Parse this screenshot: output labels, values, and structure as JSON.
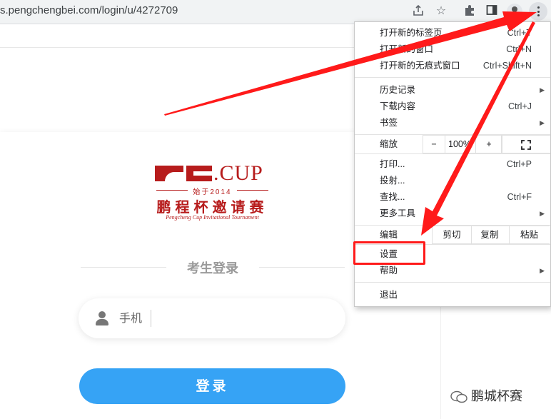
{
  "browser": {
    "url": "s.pengchengbei.com/login/u/4272709",
    "icons": [
      "share-icon",
      "star-icon",
      "extensions-icon",
      "side-panel-icon",
      "profile-icon",
      "menu-icon"
    ]
  },
  "logo": {
    "cup_text": ".CUP",
    "since": "始于2014",
    "name_cn": "鹏程杯邀请赛",
    "name_en": "Pengcheng Cup Invitational Tournament"
  },
  "login": {
    "title": "考生登录",
    "phone_placeholder": "手机",
    "button_label": "登录"
  },
  "menu": {
    "new_tab": {
      "label": "打开新的标签页",
      "shortcut": "Ctrl+T"
    },
    "new_window": {
      "label": "打开新的窗口",
      "shortcut": "Ctrl+N"
    },
    "incognito": {
      "label": "打开新的无痕式窗口",
      "shortcut": "Ctrl+Shift+N"
    },
    "history": {
      "label": "历史记录"
    },
    "downloads": {
      "label": "下载内容",
      "shortcut": "Ctrl+J"
    },
    "bookmarks": {
      "label": "书签"
    },
    "zoom": {
      "label": "缩放",
      "minus": "−",
      "value": "100%",
      "plus": "+"
    },
    "print": {
      "label": "打印...",
      "shortcut": "Ctrl+P"
    },
    "cast": {
      "label": "投射..."
    },
    "find": {
      "label": "查找...",
      "shortcut": "Ctrl+F"
    },
    "more_tools": {
      "label": "更多工具"
    },
    "edit": {
      "label": "编辑",
      "cut": "剪切",
      "copy": "复制",
      "paste": "粘贴"
    },
    "settings": {
      "label": "设置"
    },
    "help": {
      "label": "帮助"
    },
    "exit": {
      "label": "退出"
    }
  },
  "watermark": {
    "text": "鹏城杯赛"
  },
  "annotation": {
    "color": "#ff1a1a"
  }
}
